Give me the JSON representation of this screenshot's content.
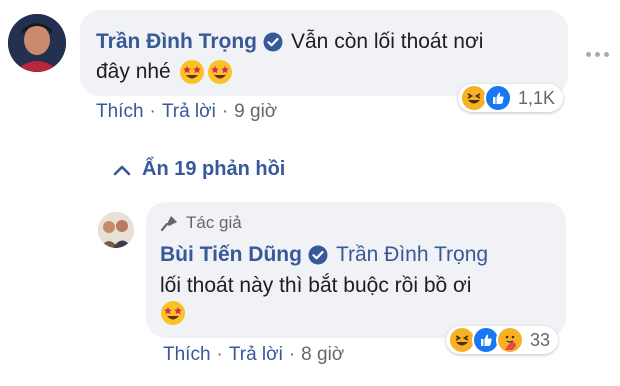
{
  "comment1": {
    "author": "Trần Đình Trọng",
    "text_line1": "Vẫn còn lối thoát nơi",
    "text_line2": "đây nhé",
    "actions": {
      "like": "Thích",
      "reply": "Trả lời",
      "time": "9 giờ"
    },
    "reactions": {
      "count": "1,1K",
      "icons": [
        "haha-icon",
        "like-icon"
      ]
    }
  },
  "replies_toggle": {
    "label": "Ẩn 19 phản hồi"
  },
  "reply1": {
    "author_badge": "Tác giả",
    "author": "Bùi Tiến Dũng",
    "mention": "Trần Đình Trọng",
    "text_line1": "lối thoát này thì bắt buộc rồi bồ ơi",
    "actions": {
      "like": "Thích",
      "reply": "Trả lời",
      "time": "8 giờ"
    },
    "reactions": {
      "count": "33",
      "icons": [
        "haha-icon",
        "like-icon",
        "care-icon"
      ]
    }
  },
  "colors": {
    "link": "#385898",
    "bubble": "#f0f2f5",
    "meta": "#65676b",
    "like": "#1877f2",
    "haha": "#f7b125"
  }
}
